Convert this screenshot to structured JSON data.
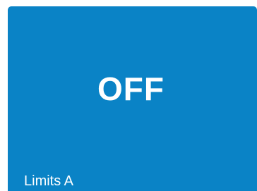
{
  "tile": {
    "state": "OFF",
    "caption": "Limits A",
    "background_color": "#0a83c6",
    "text_color": "#ffffff"
  }
}
